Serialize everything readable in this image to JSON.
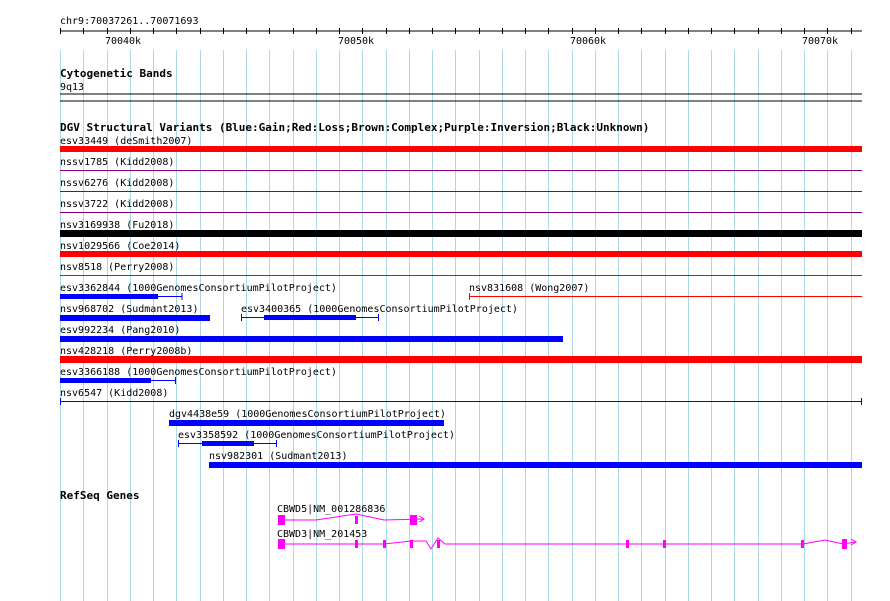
{
  "location": "chr9:70037261..70071693",
  "ruler": {
    "ticks": [
      "70040k",
      "70050k",
      "70060k",
      "70070k"
    ]
  },
  "cytoband": {
    "title": "Cytogenetic Bands",
    "label": "9q13"
  },
  "dgv": {
    "title": "DGV Structural Variants (Blue:Gain;Red:Loss;Brown:Complex;Purple:Inversion;Black:Unknown)",
    "colors": {
      "gain": "#0000ff",
      "loss": "#ff0000",
      "complex": "#8b4513",
      "inversion": "#800080",
      "unknown": "#000000"
    },
    "features": [
      {
        "label": "esv33449 (deSmith2007)",
        "type": "loss"
      },
      {
        "label": "nssv1785 (Kidd2008)",
        "type": "inversion"
      },
      {
        "label": "nssv6276 (Kidd2008)",
        "type": "inversion"
      },
      {
        "label": "nssv3722 (Kidd2008)",
        "type": "inversion"
      },
      {
        "label": "nsv3169938 (Fu2018)",
        "type": "unknown"
      },
      {
        "label": "nsv1029566 (Coe2014)",
        "type": "loss"
      },
      {
        "label": "nsv8518 (Perry2008)",
        "type": "loss"
      },
      {
        "label": "esv3362844 (1000GenomesConsortiumPilotProject)",
        "type": "gain"
      },
      {
        "label": "nsv831608 (Wong2007)",
        "type": "loss"
      },
      {
        "label": "nsv968702 (Sudmant2013)",
        "type": "gain"
      },
      {
        "label": "esv3400365 (1000GenomesConsortiumPilotProject)",
        "type": "gain"
      },
      {
        "label": "esv992234 (Pang2010)",
        "type": "gain"
      },
      {
        "label": "nsv428218 (Perry2008b)",
        "type": "loss"
      },
      {
        "label": "esv3366188 (1000GenomesConsortiumPilotProject)",
        "type": "gain"
      },
      {
        "label": "nsv6547 (Kidd2008)",
        "type": "gain"
      },
      {
        "label": "dgv4438e59 (1000GenomesConsortiumPilotProject)",
        "type": "gain"
      },
      {
        "label": "esv3358592 (1000GenomesConsortiumPilotProject)",
        "type": "gain"
      },
      {
        "label": "nsv982301 (Sudmant2013)",
        "type": "gain"
      }
    ]
  },
  "refseq": {
    "title": "RefSeq Genes",
    "color": "#ff00ff",
    "genes": [
      {
        "label": "CBWD5|NM_001286836"
      },
      {
        "label": "CBWD3|NM_201453"
      }
    ]
  }
}
